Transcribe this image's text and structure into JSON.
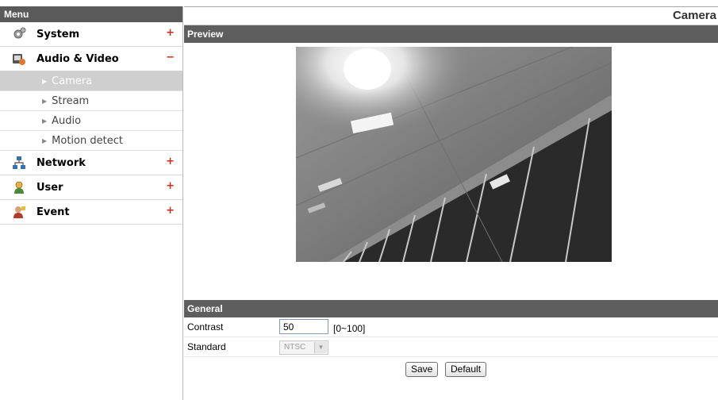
{
  "sidebar": {
    "header": "Menu",
    "items": [
      {
        "label": "System",
        "toggle": "+",
        "icon": "system-icon"
      },
      {
        "label": "Audio & Video",
        "toggle": "−",
        "icon": "audio-video-icon",
        "children": [
          {
            "label": "Camera",
            "active": true
          },
          {
            "label": "Stream"
          },
          {
            "label": "Audio"
          },
          {
            "label": "Motion detect"
          }
        ]
      },
      {
        "label": "Network",
        "toggle": "+",
        "icon": "network-icon"
      },
      {
        "label": "User",
        "toggle": "+",
        "icon": "user-icon"
      },
      {
        "label": "Event",
        "toggle": "+",
        "icon": "event-icon"
      }
    ],
    "submenu_arrow": "▶"
  },
  "page": {
    "title": "Camera",
    "preview_section": "Preview",
    "general_section": "General"
  },
  "form": {
    "contrast_label": "Contrast",
    "contrast_value": "50",
    "contrast_range": "[0~100]",
    "standard_label": "Standard",
    "standard_value": "NTSC",
    "standard_arrow": "▼"
  },
  "buttons": {
    "save": "Save",
    "default": "Default"
  },
  "colors": {
    "section_bar": "#5e5e5e",
    "active_submenu": "#cfcfcf",
    "toggle_red": "#d42a1a"
  }
}
